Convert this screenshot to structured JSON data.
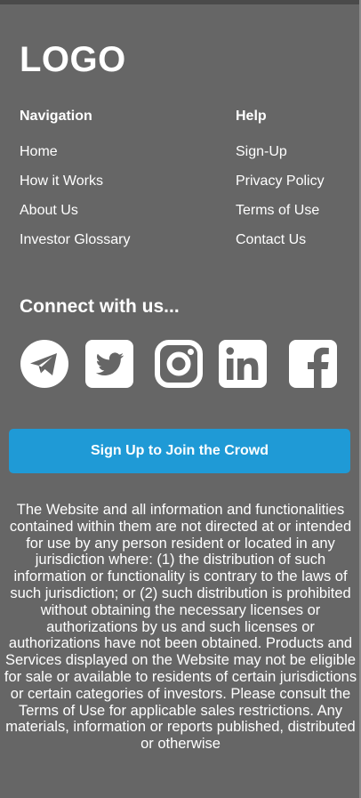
{
  "logo": "LOGO",
  "navigation": {
    "heading": "Navigation",
    "links": [
      "Home",
      "How it Works",
      "About Us",
      "Investor Glossary"
    ]
  },
  "help": {
    "heading": "Help",
    "links": [
      "Sign-Up",
      "Privacy Policy",
      "Terms of Use",
      "Contact Us"
    ]
  },
  "connect": {
    "heading": "Connect with us...",
    "icons": [
      "telegram-icon",
      "twitter-icon",
      "instagram-icon",
      "linkedin-icon",
      "facebook-icon"
    ]
  },
  "cta": {
    "label": "Sign Up to Join the Crowd"
  },
  "disclaimer": "The Website and all information and functionalities contained within them are not directed at or intended for use by any person resident or located in any jurisdiction where: (1) the distribution of such information or functionality is contrary to the laws of such jurisdiction; or (2) such distribution is prohibited without obtaining the necessary licenses or authorizations by us and such licenses or authorizations have not been obtained. Products and Services displayed on the Website may not be eligible for sale or available to residents of certain jurisdictions or certain categories of investors. Please consult the Terms of Use for applicable sales restrictions. Any materials, information or reports published, distributed or otherwise",
  "colors": {
    "background": "#666666",
    "accent": "#1f9ad6",
    "text": "#ffffff"
  }
}
